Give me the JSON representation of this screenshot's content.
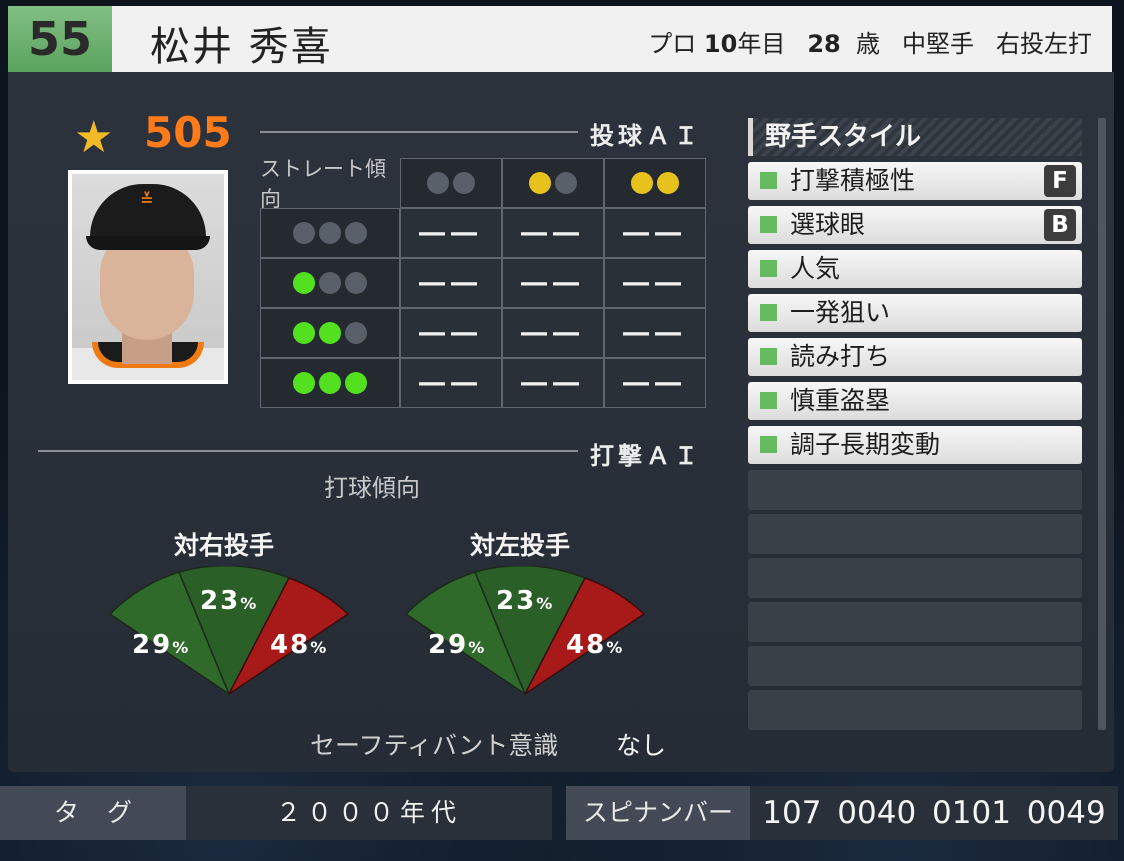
{
  "header": {
    "number": "55",
    "name": "松井 秀喜",
    "pro_label": "プロ",
    "years": "10",
    "years_suffix": "年目",
    "age": "28",
    "age_suffix": "歳",
    "position": "中堅手",
    "handedness": "右投左打"
  },
  "rating": {
    "star_icon": "star-icon",
    "value": "505"
  },
  "pitching_ai": {
    "title": "投球ＡＩ",
    "corner_label": "ストレート傾向",
    "column_dots": [
      [
        "gray",
        "gray"
      ],
      [
        "yellow",
        "gray"
      ],
      [
        "yellow",
        "yellow"
      ]
    ],
    "row_dots": [
      [
        "gray",
        "gray",
        "gray"
      ],
      [
        "green",
        "gray",
        "gray"
      ],
      [
        "green",
        "green",
        "gray"
      ],
      [
        "green",
        "green",
        "green"
      ]
    ],
    "cell_value": "――",
    "dot_colors": {
      "gray": "#59606a",
      "yellow": "#e8c21c",
      "green": "#53e01f"
    }
  },
  "batting_ai": {
    "title": "打撃ＡＩ",
    "subtitle": "打球傾向",
    "vs_right": {
      "label": "対右投手",
      "left": "29",
      "center": "23",
      "right": "48"
    },
    "vs_left": {
      "label": "対左投手",
      "left": "29",
      "center": "23",
      "right": "48"
    },
    "percent_unit": "%",
    "colors": {
      "left": "#2f6a2b",
      "center": "#2a5f27",
      "right": "#a81a1a"
    }
  },
  "safety_bunt": {
    "label": "セーフティバント意識",
    "value": "なし"
  },
  "fielder_style": {
    "title": "野手スタイル",
    "items": [
      {
        "label": "打撃積極性",
        "grade": "F"
      },
      {
        "label": "選球眼",
        "grade": "B"
      },
      {
        "label": "人気",
        "grade": ""
      },
      {
        "label": "一発狙い",
        "grade": ""
      },
      {
        "label": "読み打ち",
        "grade": ""
      },
      {
        "label": "慎重盗塁",
        "grade": ""
      },
      {
        "label": "調子長期変動",
        "grade": ""
      }
    ],
    "empty_slots": 6
  },
  "footer": {
    "tag_label": "タグ",
    "tag_value": "２０００年代",
    "spin_label": "スピナンバー",
    "spin_value": "107 0040 0101 0049"
  }
}
